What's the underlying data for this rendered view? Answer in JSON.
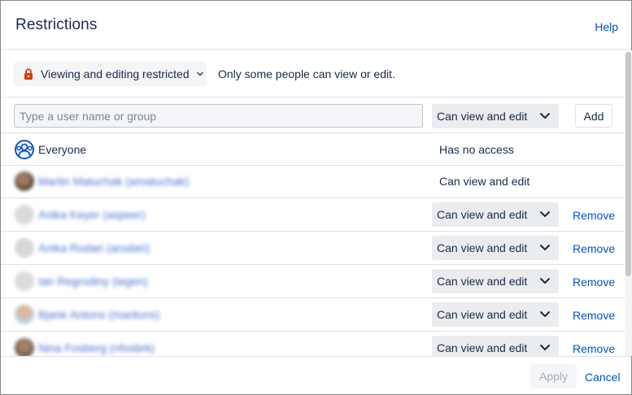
{
  "dialog": {
    "title": "Restrictions",
    "help_label": "Help"
  },
  "restriction": {
    "selected": "Viewing and editing restricted",
    "description": "Only some people can view or edit."
  },
  "add_user": {
    "placeholder": "Type a user name or group",
    "permission": "Can view and edit",
    "add_label": "Add"
  },
  "entries": [
    {
      "name": "Everyone",
      "access": "Has no access",
      "editable": false,
      "remove_label": ""
    },
    {
      "name": "Martin Matuchak (amatuchak)",
      "access": "Can view and edit",
      "editable": false,
      "remove_label": ""
    },
    {
      "name": "Anika Keyer (aspeer)",
      "access": "Can view and edit",
      "editable": true,
      "remove_label": "Remove"
    },
    {
      "name": "Anika Rodari (arodari)",
      "access": "Can view and edit",
      "editable": true,
      "remove_label": "Remove"
    },
    {
      "name": "Ian Regrodiny (iegen)",
      "access": "Can view and edit",
      "editable": true,
      "remove_label": "Remove"
    },
    {
      "name": "Bjarie Antons (mantons)",
      "access": "Can view and edit",
      "editable": true,
      "remove_label": "Remove"
    },
    {
      "name": "Nina Fosberg (nfosbrk)",
      "access": "Can view and edit",
      "editable": true,
      "remove_label": "Remove"
    }
  ],
  "footer": {
    "apply_label": "Apply",
    "cancel_label": "Cancel"
  },
  "colors": {
    "link": "#0052CC",
    "text": "#172B4D",
    "lock": "#DE350B",
    "disabled_text": "#A5ADBA"
  },
  "icons": {
    "lock": "lock-icon",
    "group": "group-icon",
    "chevron": "chevron-down-icon"
  }
}
